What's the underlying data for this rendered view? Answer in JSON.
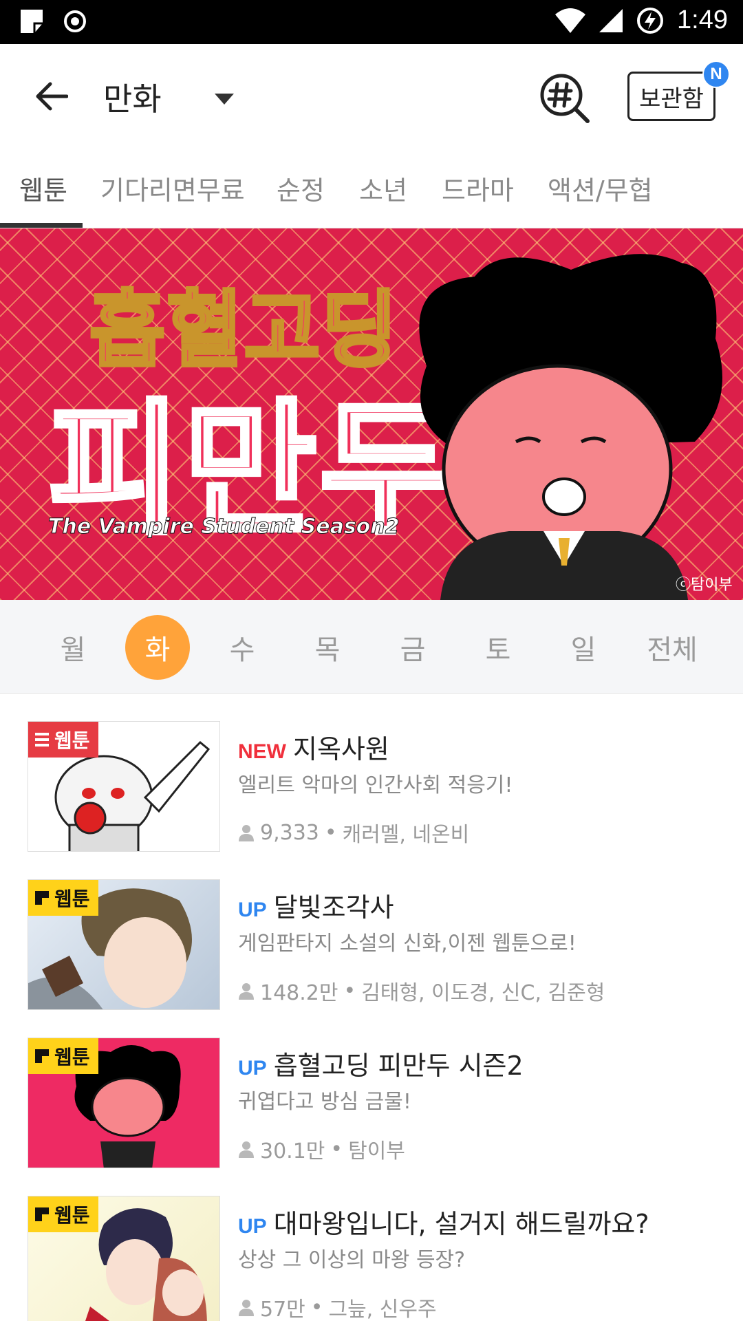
{
  "status_bar": {
    "time": "1:49"
  },
  "app_bar": {
    "title": "만화",
    "storage_label": "보관함",
    "new_badge": "N"
  },
  "tabs": [
    {
      "label": "웹툰",
      "selected": true
    },
    {
      "label": "기다리면무료"
    },
    {
      "label": "순정"
    },
    {
      "label": "소년"
    },
    {
      "label": "드라마"
    },
    {
      "label": "액션/무협"
    }
  ],
  "banner": {
    "title_line1": "흡혈고딩",
    "title_line2": "피만두",
    "subtitle": "The Vampire Student Season2",
    "credit": "ⓒ탐이부"
  },
  "days": [
    "월",
    "화",
    "수",
    "목",
    "금",
    "토",
    "일",
    "전체"
  ],
  "selected_day": "화",
  "items": [
    {
      "badge": "웹툰",
      "badge_style": "red",
      "tag": "NEW",
      "title": "지옥사원",
      "desc": "엘리트 악마의 인간사회 적응기!",
      "views": "9,333",
      "authors": "캐러멜, 네온비"
    },
    {
      "badge": "웹툰",
      "badge_style": "yellow",
      "tag": "UP",
      "title": "달빛조각사",
      "desc": "게임판타지 소설의 신화,이젠 웹툰으로!",
      "views": "148.2만",
      "authors": "김태형, 이도경, 신C, 김준형"
    },
    {
      "badge": "웹툰",
      "badge_style": "yellow",
      "tag": "UP",
      "title": "흡혈고딩 피만두 시즌2",
      "desc": "귀엽다고 방심 금물!",
      "views": "30.1만",
      "authors": "탐이부"
    },
    {
      "badge": "웹툰",
      "badge_style": "yellow",
      "tag": "UP",
      "title": "대마왕입니다, 설거지 해드릴까요?",
      "desc": "상상 그 이상의 마왕 등장?",
      "views": "57만",
      "authors": "그늪, 신우주"
    }
  ],
  "colors": {
    "accent_orange": "#ffa33a",
    "new_red": "#f0303c",
    "up_blue": "#2f86f0",
    "banner_red": "#dc1f4a"
  }
}
